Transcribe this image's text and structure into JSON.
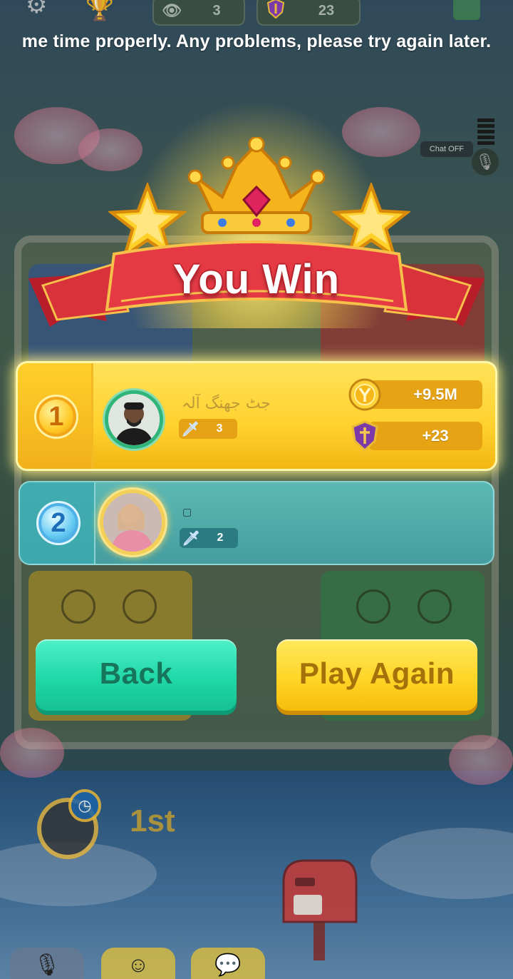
{
  "hud": {
    "spectators": "3",
    "stake": "23",
    "chat_off_label": "Chat OFF"
  },
  "notice_text": "me time properly. Any problems, please try again later.",
  "result": {
    "title": "You Win",
    "players": [
      {
        "rank": "1",
        "name": "جٹ جھنگ آلہ",
        "score": "3",
        "coins_reward": "+9.5M",
        "trophy_reward": "+23"
      },
      {
        "rank": "2",
        "name": "▢",
        "score": "2"
      }
    ]
  },
  "buttons": {
    "back": "Back",
    "play_again": "Play Again"
  },
  "board": {
    "my_place": "1st"
  },
  "colors": {
    "first_row": "#ffd12d",
    "second_row": "#5fc8c8",
    "back_button": "#20d8a7",
    "play_again_button": "#ffd527",
    "ribbon": "#d8323b"
  }
}
